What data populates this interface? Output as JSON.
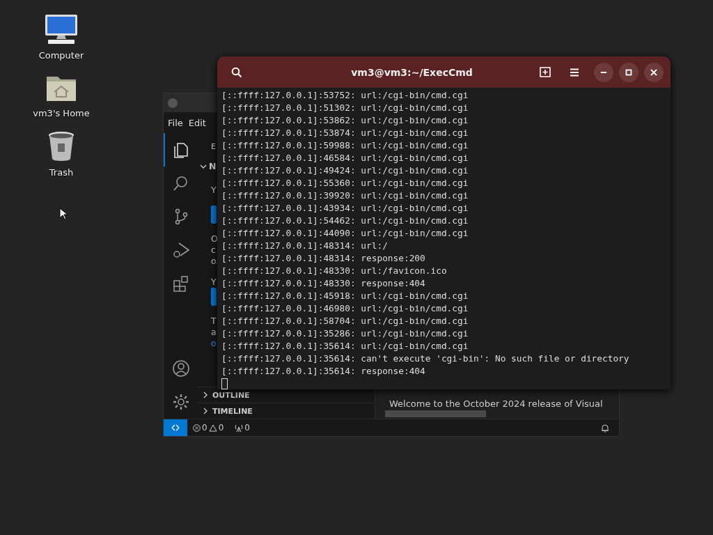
{
  "desktop_icons": [
    {
      "kind": "computer",
      "label": "Computer"
    },
    {
      "kind": "home",
      "label": "vm3's Home"
    },
    {
      "kind": "trash",
      "label": "Trash"
    }
  ],
  "editor_window": {
    "menu": [
      "File",
      "Edit"
    ],
    "activity_bar": [
      {
        "kind": "files",
        "selected": true
      },
      {
        "kind": "search",
        "selected": false
      },
      {
        "kind": "source-control",
        "selected": false
      },
      {
        "kind": "run-debug",
        "selected": false
      },
      {
        "kind": "extensions",
        "selected": false
      }
    ],
    "activity_bottom": [
      {
        "kind": "account"
      },
      {
        "kind": "settings"
      }
    ],
    "sidebar_fragments": [
      {
        "kind": "title",
        "text": "E"
      },
      {
        "kind": "section",
        "text": "N"
      },
      {
        "kind": "text",
        "text": "Y"
      },
      {
        "kind": "button"
      },
      {
        "kind": "text",
        "text": "O"
      },
      {
        "kind": "text",
        "text": "c"
      },
      {
        "kind": "text",
        "text": "o"
      },
      {
        "kind": "text",
        "text": "Y"
      },
      {
        "kind": "button"
      },
      {
        "kind": "text",
        "text": "T"
      },
      {
        "kind": "text",
        "text": "a"
      },
      {
        "kind": "link",
        "text": "o"
      }
    ],
    "panels": [
      {
        "label": "OUTLINE",
        "expanded": false
      },
      {
        "label": "TIMELINE",
        "expanded": false
      }
    ],
    "editor_text": "Welcome to the October 2024 release of Visual",
    "status_bar": {
      "errors": "0",
      "warnings": "0",
      "ports": "0"
    }
  },
  "terminal": {
    "title": "vm3@vm3:~/ExecCmd",
    "lines": [
      "[::ffff:127.0.0.1]:53752: url:/cgi-bin/cmd.cgi",
      "[::ffff:127.0.0.1]:51302: url:/cgi-bin/cmd.cgi",
      "[::ffff:127.0.0.1]:53862: url:/cgi-bin/cmd.cgi",
      "[::ffff:127.0.0.1]:53874: url:/cgi-bin/cmd.cgi",
      "[::ffff:127.0.0.1]:59988: url:/cgi-bin/cmd.cgi",
      "[::ffff:127.0.0.1]:46584: url:/cgi-bin/cmd.cgi",
      "[::ffff:127.0.0.1]:49424: url:/cgi-bin/cmd.cgi",
      "[::ffff:127.0.0.1]:55360: url:/cgi-bin/cmd.cgi",
      "[::ffff:127.0.0.1]:39920: url:/cgi-bin/cmd.cgi",
      "[::ffff:127.0.0.1]:43934: url:/cgi-bin/cmd.cgi",
      "[::ffff:127.0.0.1]:54462: url:/cgi-bin/cmd.cgi",
      "[::ffff:127.0.0.1]:44090: url:/cgi-bin/cmd.cgi",
      "[::ffff:127.0.0.1]:48314: url:/",
      "[::ffff:127.0.0.1]:48314: response:200",
      "[::ffff:127.0.0.1]:48330: url:/favicon.ico",
      "[::ffff:127.0.0.1]:48330: response:404",
      "[::ffff:127.0.0.1]:45918: url:/cgi-bin/cmd.cgi",
      "[::ffff:127.0.0.1]:46980: url:/cgi-bin/cmd.cgi",
      "[::ffff:127.0.0.1]:58704: url:/cgi-bin/cmd.cgi",
      "[::ffff:127.0.0.1]:35286: url:/cgi-bin/cmd.cgi",
      "[::ffff:127.0.0.1]:35614: url:/cgi-bin/cmd.cgi",
      "[::ffff:127.0.0.1]:35614: can't execute 'cgi-bin': No such file or directory",
      "[::ffff:127.0.0.1]:35614: response:404"
    ]
  }
}
